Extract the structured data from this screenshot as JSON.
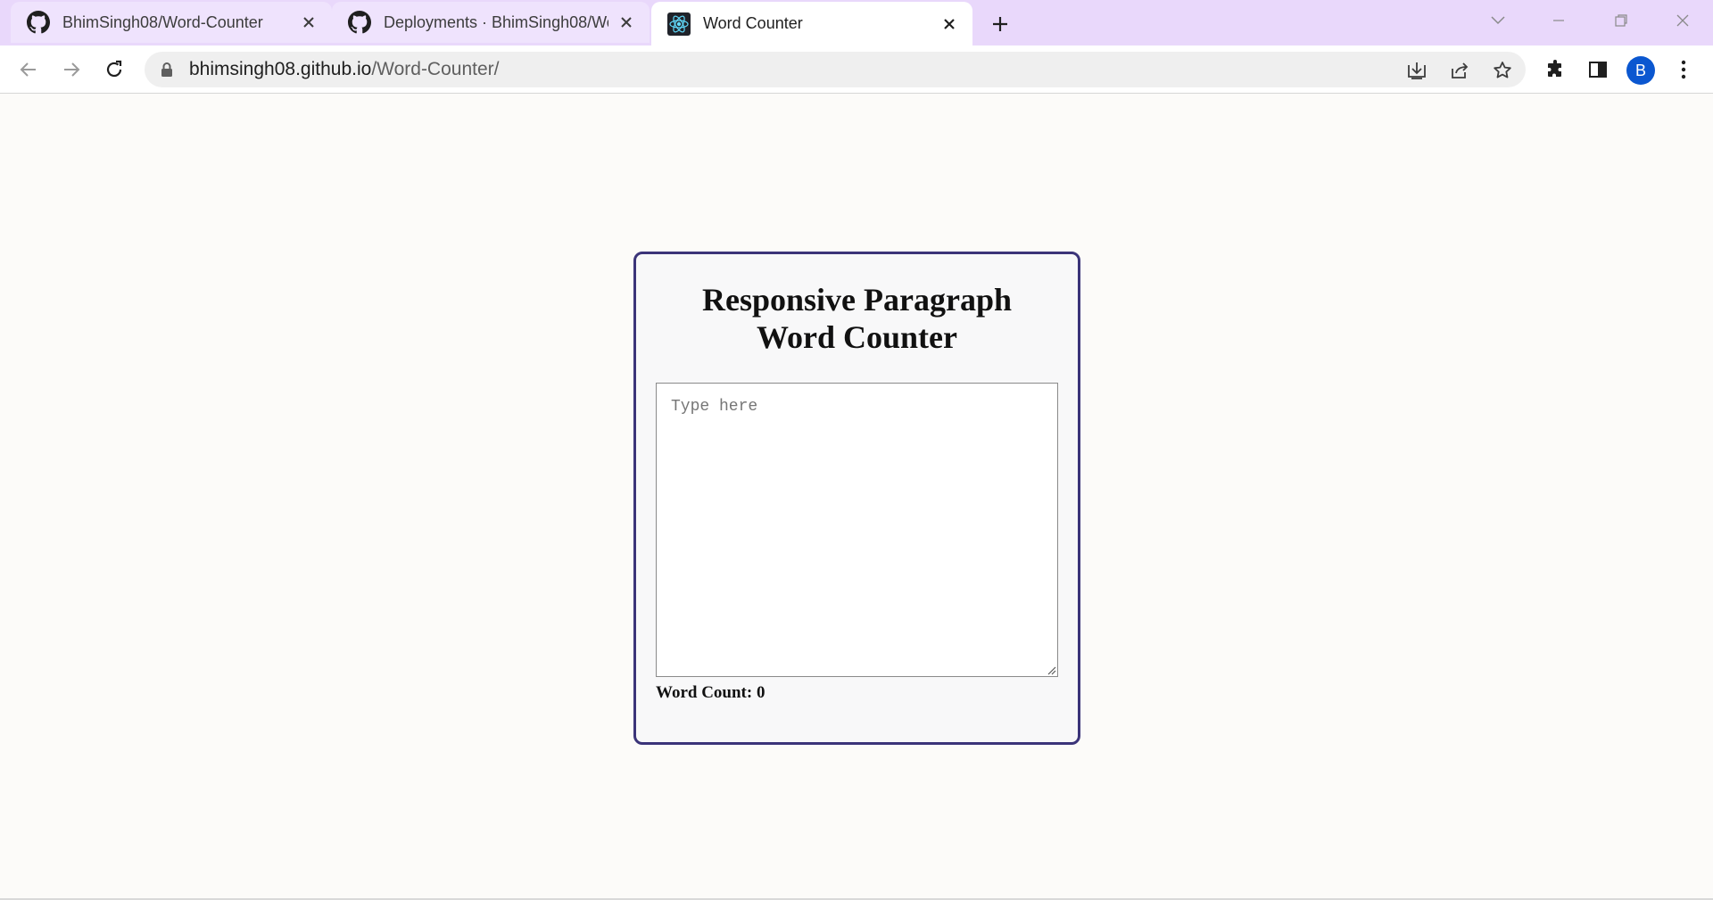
{
  "browser": {
    "tabs": [
      {
        "title": "BhimSingh08/Word-Counter",
        "favicon": "github-icon",
        "active": false
      },
      {
        "title": "Deployments · BhimSingh08/Wo",
        "favicon": "github-icon",
        "active": false
      },
      {
        "title": "Word Counter",
        "favicon": "react-icon",
        "active": true
      }
    ],
    "address": {
      "domain": "bhimsingh08.github.io",
      "path": "/Word-Counter/"
    },
    "profile_initial": "B",
    "colors": {
      "tabstrip": "#e9d8fb",
      "avatar": "#0b57d0"
    }
  },
  "page": {
    "heading_line1": "Responsive Paragraph",
    "heading_line2": "Word Counter",
    "textarea": {
      "placeholder": "Type here",
      "value": ""
    },
    "word_count_label": "Word Count: ",
    "word_count_value": "0",
    "colors": {
      "card_border": "#3b3479"
    }
  }
}
